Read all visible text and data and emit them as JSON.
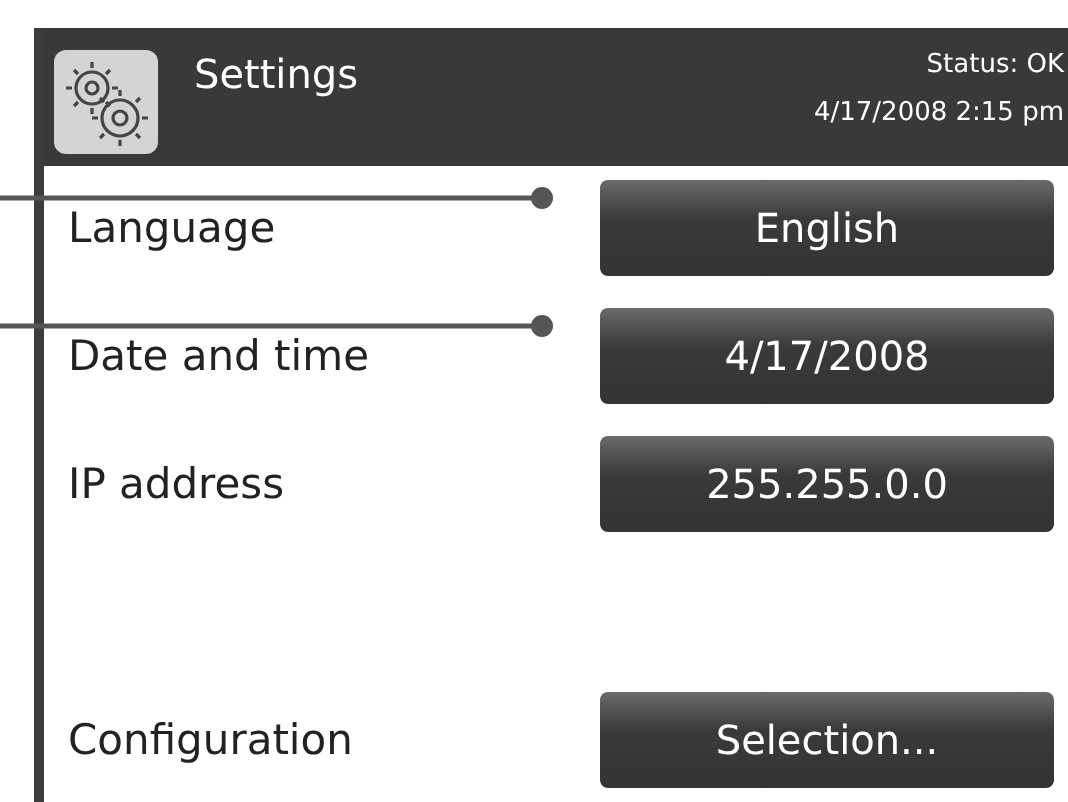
{
  "header": {
    "title": "Settings",
    "status": "Status: OK",
    "datetime": "4/17/2008 2:15 pm"
  },
  "rows": [
    {
      "label": "Language",
      "value": "English",
      "callout": true
    },
    {
      "label": "Date and time",
      "value": "4/17/2008",
      "callout": true
    },
    {
      "label": "IP address",
      "value": "255.255.0.0",
      "callout": false
    },
    {
      "label": "Configuration",
      "value": "Selection...",
      "callout": false
    }
  ]
}
